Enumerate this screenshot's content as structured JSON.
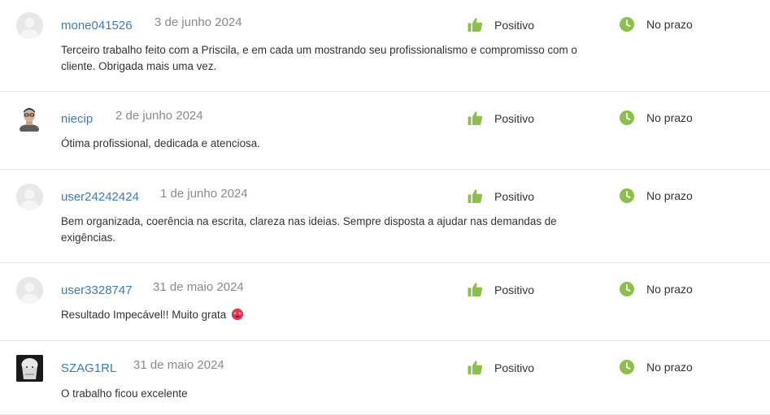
{
  "reviews": [
    {
      "username": "mone041526",
      "date": "3 de junho 2024",
      "rating": "Positivo",
      "delivery": "No prazo",
      "comment": "Terceiro trabalho feito com a Priscila, e em cada um mostrando seu profissionalismo e compromisso com o cliente. Obrigada mais uma vez.",
      "avatar": "default-avatar-icon"
    },
    {
      "username": "niecip",
      "date": "2 de junho 2024",
      "rating": "Positivo",
      "delivery": "No prazo",
      "comment": "Ótima profissional, dedicada e atenciosa.",
      "avatar": "person-avatar"
    },
    {
      "username": "user24242424",
      "date": "1 de junho 2024",
      "rating": "Positivo",
      "delivery": "No prazo",
      "comment": "Bem organizada, coerência na escrita, clareza nas ideias. Sempre disposta a ajudar nas demandas de exigências.",
      "avatar": "default-avatar-icon"
    },
    {
      "username": "user3328747",
      "date": "31 de maio 2024",
      "rating": "Positivo",
      "delivery": "No prazo",
      "comment": "Resultado Impecável!! Muito grata",
      "emoji": "star-struck-emoji",
      "avatar": "default-avatar-icon"
    },
    {
      "username": "SZAG1RL",
      "date": "31 de maio 2024",
      "rating": "Positivo",
      "delivery": "No prazo",
      "comment": "O trabalho ficou excelente",
      "avatar": "drawing-avatar"
    }
  ],
  "colors": {
    "username": "#3d7bb5",
    "date": "#8a8a8a",
    "icon_green": "#8cc04b",
    "divider": "#e6e6e6"
  }
}
